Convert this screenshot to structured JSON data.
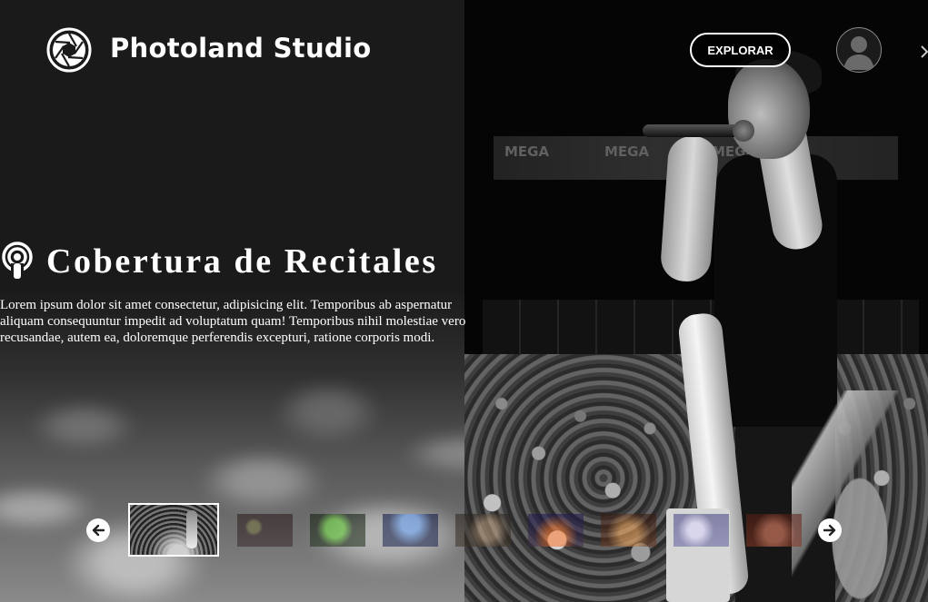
{
  "header": {
    "brand": "Photoland Studio",
    "explore_label": "EXPLORAR",
    "logo_icon": "camera-aperture-icon",
    "avatar_icon": "user-avatar-icon"
  },
  "background_banner": [
    "MEGA",
    "MEGA",
    "MEGA"
  ],
  "hero": {
    "icon": "podcast-broadcast-icon",
    "title": "Cobertura de Recitales",
    "description": "Lorem ipsum dolor sit amet consectetur, adipisicing elit. Temporibus ab aspernatur aliquam consequuntur impedit ad voluptatum quam! Temporibus nihil molestiae vero recusandae, autem ea, doloremque perferendis excepturi, ratione corporis modi."
  },
  "carousel": {
    "prev_icon": "arrow-left-icon",
    "next_icon": "arrow-right-icon",
    "thumbnail_count": 9,
    "active_index": 0
  },
  "colors": {
    "panel": "#1a1a1a",
    "text": "#ffffff",
    "button_border": "#ffffff"
  }
}
